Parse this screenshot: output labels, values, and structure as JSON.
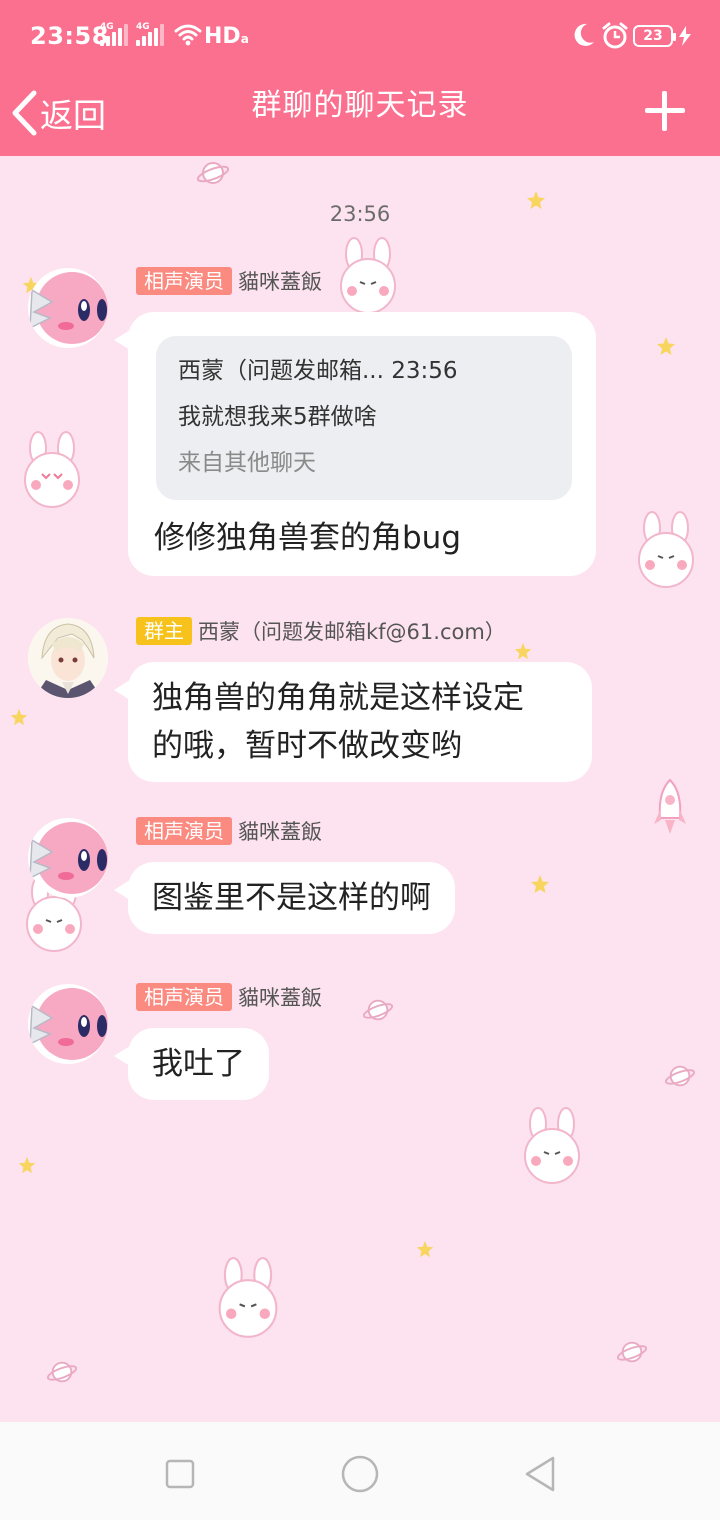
{
  "status_bar": {
    "time": "23:58",
    "sim1_tag": "4G",
    "sim2_tag": "4G",
    "hd_label": "HD",
    "hd_sub": "a",
    "battery": "23",
    "icons": [
      "signal-icon",
      "signal-icon",
      "wifi-icon",
      "moon-icon",
      "alarm-icon",
      "battery-icon",
      "charging-icon"
    ]
  },
  "header": {
    "back_label": "返回",
    "title": "群聊的聊天记录",
    "back_icon": "chevron-left-icon",
    "menu_icon": "plus-icon"
  },
  "chat": {
    "timestamp": "23:56",
    "messages": [
      {
        "badge": "相声演员",
        "sender": "貓咪蓋飯",
        "quote": {
          "header": "西蒙（问题发邮箱... 23:56",
          "text": "我就想我来5群做啥",
          "source": "来自其他聊天"
        },
        "text": "修修独角兽套的角bug"
      },
      {
        "badge": "群主",
        "sender": "西蒙（问题发邮箱kf@61.com）",
        "text_lines": [
          "独角兽的角角就是这样设定",
          "的哦，暂时不做改变哟"
        ]
      },
      {
        "badge": "相声演员",
        "sender": "貓咪蓋飯",
        "text": "图鉴里不是这样的啊"
      },
      {
        "badge": "相声演员",
        "sender": "貓咪蓋飯",
        "text": "我吐了"
      }
    ]
  },
  "nav": {
    "icons": [
      "recent-apps-icon",
      "home-icon",
      "back-icon"
    ]
  },
  "colors": {
    "header": "#fb6f8f",
    "background": "#fde3ef",
    "badge_member": "#fb8a80",
    "badge_owner": "#f6c21b",
    "quote_bg": "#eceef1"
  }
}
